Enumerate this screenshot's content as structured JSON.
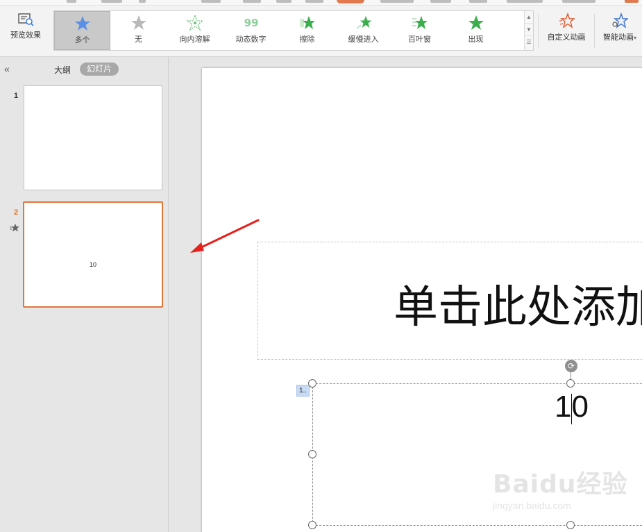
{
  "ribbon": {
    "preview_label": "预览效果",
    "gallery": [
      {
        "label": "多个",
        "icon": "star-blue-icon",
        "color": "#5b8fe6",
        "selected": true
      },
      {
        "label": "无",
        "icon": "star-gray-icon",
        "color": "#b9b9b9",
        "selected": false
      },
      {
        "label": "向内溶解",
        "icon": "dissolve-star-icon",
        "color": "#6ec07a",
        "selected": false
      },
      {
        "label": "动态数字",
        "icon": "number-99-icon",
        "color": "#6ec07a",
        "selected": false
      },
      {
        "label": "擦除",
        "icon": "wipe-star-icon",
        "color": "#3cae4d",
        "selected": false
      },
      {
        "label": "缓慢进入",
        "icon": "slow-in-star-icon",
        "color": "#3cae4d",
        "selected": false
      },
      {
        "label": "百叶窗",
        "icon": "blinds-star-icon",
        "color": "#3cae4d",
        "selected": false
      },
      {
        "label": "出现",
        "icon": "appear-star-icon",
        "color": "#3cae4d",
        "selected": false
      }
    ],
    "custom_anim_label": "自定义动画",
    "smart_anim_label": "智能动画",
    "smart_anim_caret": "▾"
  },
  "left_pane": {
    "collapse_glyph": "«",
    "tab_outline": "大纲",
    "tab_slides": "幻灯片",
    "thumbnails": [
      {
        "number": "1",
        "text": ""
      },
      {
        "number": "2",
        "text": "10"
      }
    ]
  },
  "slide": {
    "title_text": "单击此处添加",
    "body_text": "10",
    "anim_tag": "1.."
  },
  "watermark": {
    "brand": "Baidu经验",
    "url": "jingyan.baidu.com"
  },
  "colors": {
    "accent_orange": "#e2763b",
    "arrow_red": "#e8201c",
    "ribbon_bg": "#f3f3f3"
  }
}
